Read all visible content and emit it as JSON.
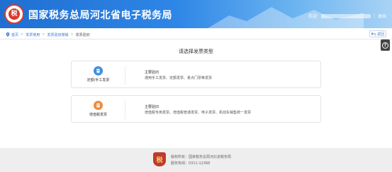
{
  "header": {
    "title": "国家税务总局河北省电子税务局",
    "welcome": "欢迎:",
    "separator": "|",
    "logout": "退出"
  },
  "logo": {
    "glyph": "税"
  },
  "breadcrumb": {
    "items": [
      "首页",
      "发票使用",
      "发票验旧缴销",
      "发票验旧"
    ],
    "separator": ">"
  },
  "back_button": {
    "label": "返回"
  },
  "help": {
    "glyph": "?"
  },
  "main": {
    "prompt": "请选择发票类型",
    "cards": [
      {
        "name": "定额/手工发票",
        "icon": "invoice-icon",
        "desc_title": "主要验旧",
        "desc_text": "通用手工发票、定额发票、景点门票等发票"
      },
      {
        "name": "增值税发票",
        "icon": "invoice-icon",
        "desc_title": "主要验旧",
        "desc_text": "增值税专用发票、增值税普通发票、电子发票、机动车销售统一发票"
      }
    ]
  },
  "footer": {
    "emblem_glyph": "税",
    "copyright": "版权所有：国家税务总局河北省税务局",
    "hotline": "服务热线：0311-12366"
  },
  "colors": {
    "header_blue": "#2e86e6",
    "link_blue": "#3a7bd5",
    "card_icon_blue": "#3d8fe0",
    "card_icon_orange": "#f08b3c",
    "emblem_red": "#c23a2b"
  }
}
